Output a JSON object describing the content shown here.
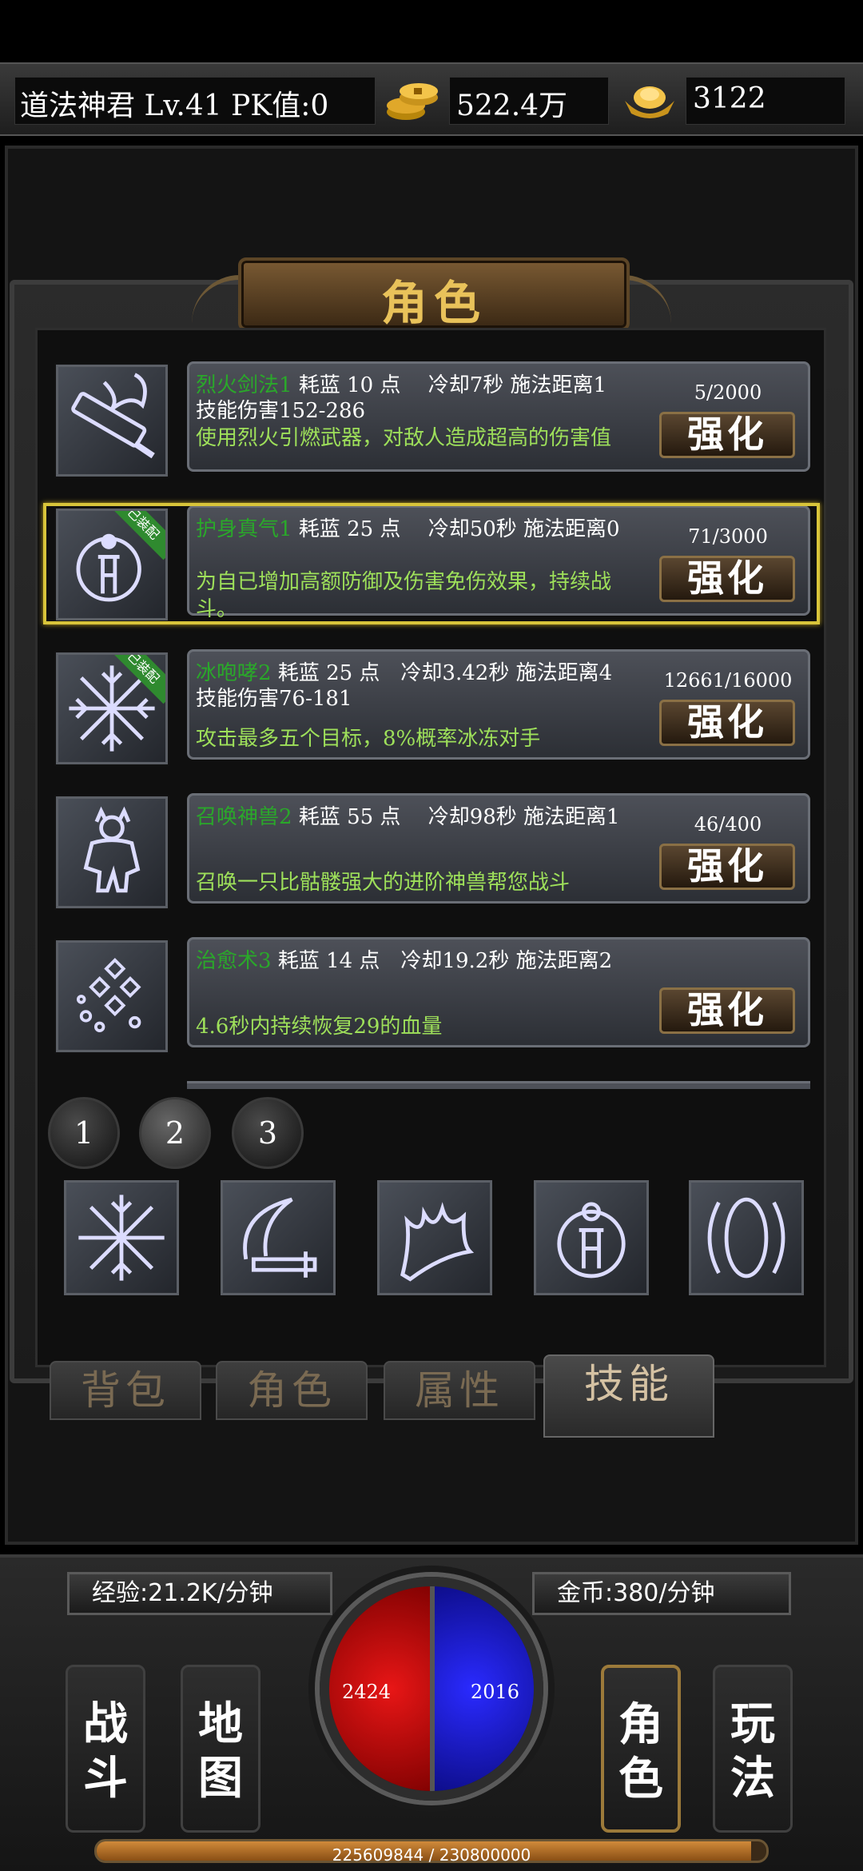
{
  "header": {
    "player_info": "道法神君  Lv.41 PK值:0",
    "gold": "522.4万",
    "ingot": "3122",
    "gold_icon": "gold-coins-icon",
    "ingot_icon": "gold-ingot-icon"
  },
  "panel": {
    "title": "角色"
  },
  "skills": [
    {
      "name": "烈火剑法1",
      "info": " 耗蓝 10 点　 冷却7秒  施法距离1",
      "damage": "技能伤害152-286",
      "desc": "使用烈火引燃武器，对敌人造成超高的伤害值",
      "progress": "5/2000",
      "button": "强化",
      "icon": "flaming-sword-icon"
    },
    {
      "name": "护身真气1",
      "info": " 耗蓝 25 点　 冷却50秒 施法距离0",
      "damage": "",
      "desc": "为自已增加高额防御及伤害免伤效果，持续战斗。",
      "progress": "71/3000",
      "button": "强化",
      "badge": "已装配",
      "icon": "shield-warrior-icon"
    },
    {
      "name": "冰咆哮2",
      "info": " 耗蓝 25 点　冷却3.42秒  施法距离4",
      "damage": "技能伤害76-181",
      "desc": "攻击最多五个目标，8%概率冰冻对手",
      "progress": "12661/16000",
      "button": "强化",
      "badge": "已装配",
      "icon": "snowflake-icon"
    },
    {
      "name": "召唤神兽2",
      "info": " 耗蓝 55 点　 冷却98秒 施法距离1",
      "damage": "",
      "desc": "召唤一只比骷髅强大的进阶神兽帮您战斗",
      "progress": "46/400",
      "button": "强化",
      "icon": "summon-beast-icon"
    },
    {
      "name": "治愈术3",
      "info": " 耗蓝 14 点　冷却19.2秒  施法距离2",
      "damage": "",
      "desc": "4.6秒内持续恢复29的血量",
      "progress": "",
      "button": "强化",
      "icon": "healing-sparkle-icon"
    }
  ],
  "pages": [
    "1",
    "2",
    "3"
  ],
  "quick_slots": [
    "snowflake-icon",
    "crescent-slash-icon",
    "flame-claw-icon",
    "shield-warrior-icon",
    "barrier-rings-icon"
  ],
  "tabs": [
    "背包",
    "角色",
    "属性",
    "技能"
  ],
  "bottom": {
    "exp_rate": "经验:21.2K/分钟",
    "gold_rate": "金币:380/分钟",
    "hp": "2424",
    "mp": "2016",
    "nav": [
      "战斗",
      "地图",
      "角色",
      "玩法"
    ],
    "exp_progress": "225609844 / 230800000",
    "exp_fraction": 0.9775
  },
  "colors": {
    "skill_name": "#2aa82a",
    "skill_desc": "#9ee05a",
    "highlight": "#d8c43a",
    "title": "#e9c25a"
  }
}
